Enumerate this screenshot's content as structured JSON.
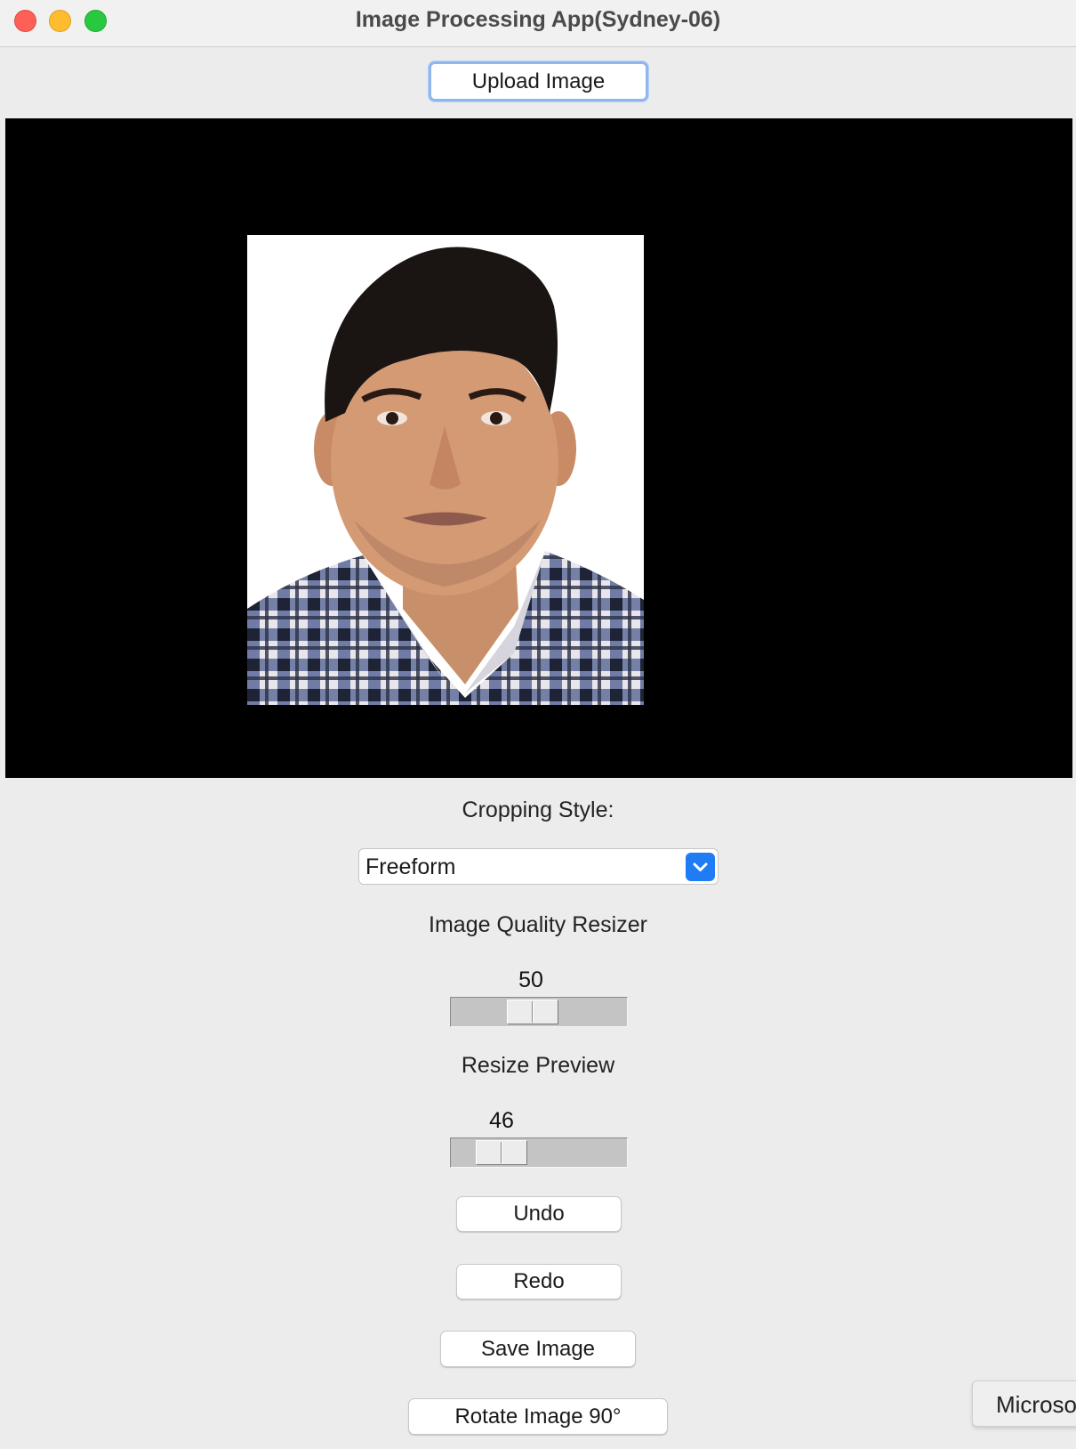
{
  "window": {
    "title": "Image Processing App(Sydney-06)"
  },
  "toolbar": {
    "upload_label": "Upload Image"
  },
  "cropping": {
    "label": "Cropping Style:",
    "selected": "Freeform"
  },
  "quality": {
    "label": "Image Quality Resizer",
    "value": "50",
    "min": 0,
    "max": 100
  },
  "resize_preview": {
    "label": "Resize Preview",
    "value": "46"
  },
  "actions": {
    "undo_label": "Undo",
    "redo_label": "Redo",
    "save_label": "Save Image",
    "rotate_label": "Rotate Image 90°"
  },
  "taskbar": {
    "partial_app_label": "Microso"
  },
  "colors": {
    "window_bg": "#ececec",
    "canvas_bg": "#000000",
    "accent": "#1f7cf5",
    "close": "#fe5f57",
    "minimize": "#febc2e",
    "maximize": "#28c840"
  }
}
